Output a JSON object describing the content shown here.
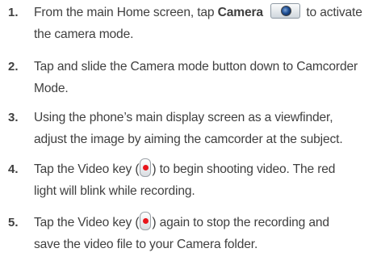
{
  "steps": [
    {
      "number": "1.",
      "line1_before": "From the main Home screen, tap",
      "line1_bold": "Camera",
      "line1_after": "to activate",
      "line2": "the camera mode."
    },
    {
      "number": "2.",
      "line1": "Tap and slide the Camera mode button down to Camcorder",
      "line2": "Mode."
    },
    {
      "number": "3.",
      "line1": "Using the phone’s main display screen as a viewfinder,",
      "line2": "adjust the image by aiming the camcorder at the subject."
    },
    {
      "number": "4.",
      "line1_before": "Tap the Video key (",
      "line1_after": ") to begin shooting video. The red",
      "line2": "light will blink while recording."
    },
    {
      "number": "5.",
      "line1_before": "Tap the Video key (",
      "line1_after": ") again to stop the recording and",
      "line2": "save the video file to your Camera folder."
    }
  ],
  "icons": {
    "camera_icon": "camera-icon",
    "video_key_icon": "video-key-icon",
    "video_dot_color": "#e8141b"
  }
}
